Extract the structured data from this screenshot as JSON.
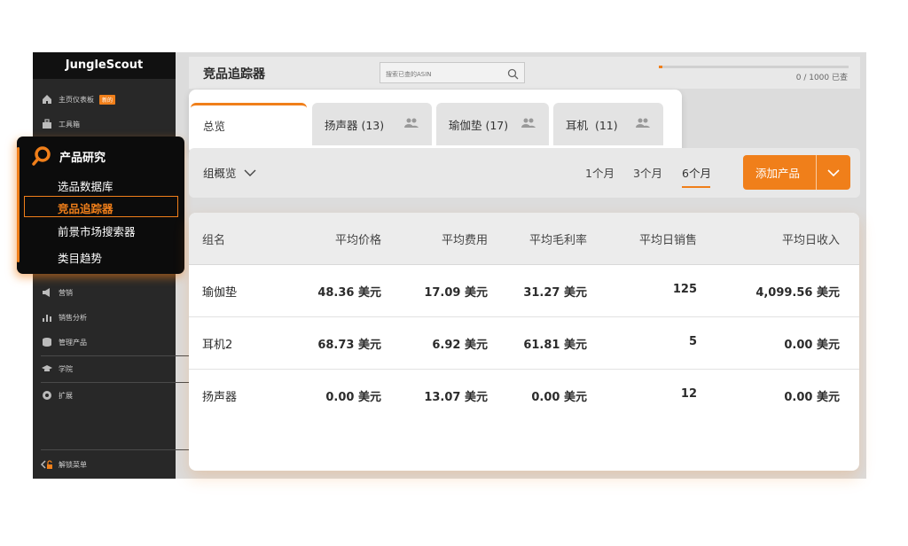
{
  "brand": "JungleScout",
  "sidebar": {
    "items": [
      {
        "label": "主页仪表板",
        "badge": "新的",
        "icon": "home-icon"
      },
      {
        "label": "工具箱",
        "icon": "toolbox-icon"
      },
      {
        "label": "营销",
        "icon": "megaphone-icon"
      },
      {
        "label": "销售分析",
        "icon": "bar-chart-icon"
      },
      {
        "label": "管理产品",
        "icon": "database-icon"
      },
      {
        "label": "学院",
        "icon": "graduation-cap-icon"
      },
      {
        "label": "扩展",
        "icon": "chrome-icon"
      }
    ],
    "unlock_menu": "解锁菜单"
  },
  "product_research": {
    "title": "产品研究",
    "items": [
      "选品数据库",
      "竞品追踪器",
      "前景市场搜索器",
      "类目趋势"
    ],
    "active_index": 1
  },
  "header": {
    "title": "竞品追踪器",
    "search_placeholder": "搜索已查的ASIN",
    "progress_text": "0 / 1000 已查",
    "progress_fraction": 0.0
  },
  "tabs": [
    {
      "label": "总览",
      "active": true
    },
    {
      "label": "扬声器 (13)",
      "active": false
    },
    {
      "label": "瑜伽垫 (17)",
      "active": false
    },
    {
      "label": "耳机  (11)",
      "active": false
    }
  ],
  "filters": {
    "group_overview": "组概览",
    "periods": [
      "1个月",
      "3个月",
      "6个月"
    ],
    "active_period": "6个月",
    "add_product": "添加产品"
  },
  "table": {
    "columns": [
      "组名",
      "平均价格",
      "平均费用",
      "平均毛利率",
      "平均日销售",
      "平均日收入"
    ],
    "rows": [
      [
        "瑜伽垫",
        "48.36 美元",
        "17.09 美元",
        "31.27 美元",
        "125",
        "4,099.56 美元"
      ],
      [
        "耳机2",
        "68.73 美元",
        "6.92 美元",
        "61.81 美元",
        "5",
        "0.00 美元"
      ],
      [
        "扬声器",
        "0.00 美元",
        "13.07 美元",
        "0.00 美元",
        "12",
        "0.00 美元"
      ]
    ]
  },
  "colors": {
    "accent": "#f07f1a",
    "sidebar": "#282828",
    "menu": "#0c0c0c"
  }
}
